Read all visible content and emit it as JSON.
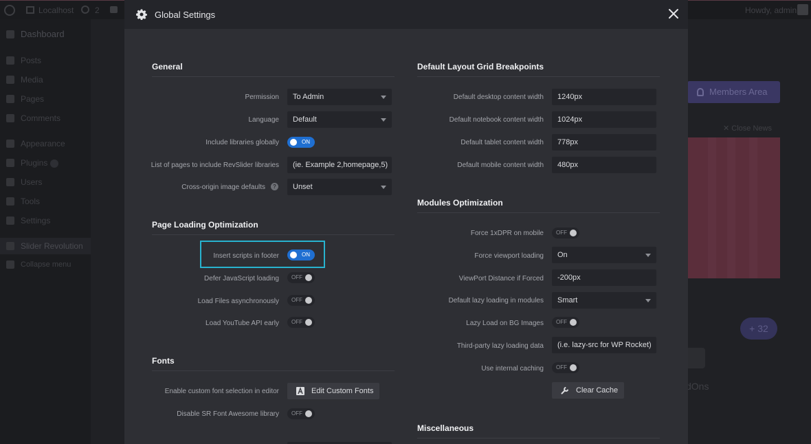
{
  "background": {
    "topbar": {
      "site_name": "Localhost",
      "updates_count": "2",
      "howdy": "Howdy, admin"
    },
    "sidebar": {
      "items": [
        {
          "label": "Dashboard"
        },
        {
          "label": "Posts"
        },
        {
          "label": "Media"
        },
        {
          "label": "Pages"
        },
        {
          "label": "Comments"
        },
        {
          "label": "Appearance"
        },
        {
          "label": "Plugins"
        },
        {
          "label": "Users"
        },
        {
          "label": "Tools"
        },
        {
          "label": "Settings"
        },
        {
          "label": "Slider Revolution"
        },
        {
          "label": "Collapse menu"
        }
      ]
    },
    "members_button": "Members Area",
    "close_news": "Close News",
    "count_badge": "+ 32",
    "addons_label": "dOns"
  },
  "modal": {
    "title": "Global Settings",
    "general": {
      "title": "General",
      "permission_label": "Permission",
      "permission_value": "To Admin",
      "language_label": "Language",
      "language_value": "Default",
      "include_libraries_label": "Include libraries globally",
      "include_libraries_state": "ON",
      "pages_include_label": "List of pages to include RevSlider libraries",
      "pages_include_placeholder": "(ie. Example 2,homepage,5)",
      "cross_origin_label": "Cross-origin image defaults",
      "cross_origin_help": "?",
      "cross_origin_value": "Unset"
    },
    "page_loading": {
      "title": "Page Loading Optimization",
      "insert_scripts_label": "Insert scripts in footer",
      "insert_scripts_state": "ON",
      "defer_js_label": "Defer JavaScript loading",
      "defer_js_state": "OFF",
      "load_async_label": "Load Files asynchronously",
      "load_async_state": "OFF",
      "youtube_label": "Load YouTube API early",
      "youtube_state": "OFF"
    },
    "fonts": {
      "title": "Fonts",
      "custom_font_label": "Enable custom font selection in editor",
      "custom_font_button": "Edit Custom Fonts",
      "disable_fa_label": "Disable SR Font Awesome library",
      "disable_fa_state": "OFF"
    },
    "breakpoints": {
      "title": "Default Layout Grid Breakpoints",
      "desktop_label": "Default desktop content width",
      "desktop_value": "1240px",
      "notebook_label": "Default notebook content width",
      "notebook_value": "1024px",
      "tablet_label": "Default tablet content width",
      "tablet_value": "778px",
      "mobile_label": "Default mobile content width",
      "mobile_value": "480px"
    },
    "modules": {
      "title": "Modules Optimization",
      "force_dpr_label": "Force 1xDPR on mobile",
      "force_dpr_state": "OFF",
      "force_viewport_label": "Force viewport loading",
      "force_viewport_value": "On",
      "viewport_distance_label": "ViewPort Distance if Forced",
      "viewport_distance_value": "-200px",
      "lazy_default_label": "Default lazy loading in modules",
      "lazy_default_value": "Smart",
      "lazy_bg_label": "Lazy Load on BG Images",
      "lazy_bg_state": "OFF",
      "third_party_label": "Third-party lazy loading data",
      "third_party_value": "(i.e. lazy-src for WP Rocket)",
      "caching_label": "Use internal caching",
      "caching_state": "OFF",
      "clear_cache_button": "Clear Cache"
    },
    "misc": {
      "title": "Miscellaneous"
    }
  },
  "colors": {
    "toggle_on": "#1f6fd1",
    "highlight": "#28b3cf",
    "modal_bg": "#2e2f34"
  }
}
